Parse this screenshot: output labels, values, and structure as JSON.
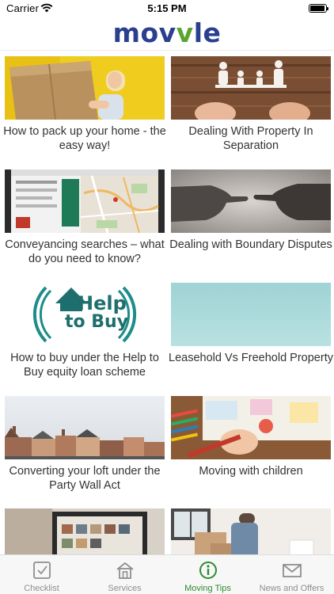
{
  "status_bar": {
    "carrier": "Carrier",
    "time": "5:15 PM",
    "battery_level": 0.95
  },
  "header": {
    "logo_part1": "mov",
    "logo_part2": "v",
    "logo_part3": "le"
  },
  "articles": [
    {
      "title": "How to pack up your home - the easy way!"
    },
    {
      "title": "Dealing With Property In Separation"
    },
    {
      "title": "Conveyancing searches – what do you need to know?"
    },
    {
      "title": "Dealing with Boundary Disputes"
    },
    {
      "title": "How to buy under the Help to Buy equity loan scheme",
      "logo_line1": "Help",
      "logo_line2": "to Buy"
    },
    {
      "title": "Leasehold Vs Freehold Property"
    },
    {
      "title": "Converting your loft under the Party Wall Act"
    },
    {
      "title": "Moving with children"
    }
  ],
  "tabs": [
    {
      "label": "Checklist",
      "icon": "checklist-icon"
    },
    {
      "label": "Services",
      "icon": "services-icon"
    },
    {
      "label": "Moving Tips",
      "icon": "info-icon",
      "active": true
    },
    {
      "label": "News and Offers",
      "icon": "mail-icon"
    }
  ],
  "colors": {
    "brand_blue": "#2b3f8f",
    "brand_green": "#5aa532",
    "tab_active": "#2e8b32",
    "tab_inactive": "#8e8e93"
  }
}
